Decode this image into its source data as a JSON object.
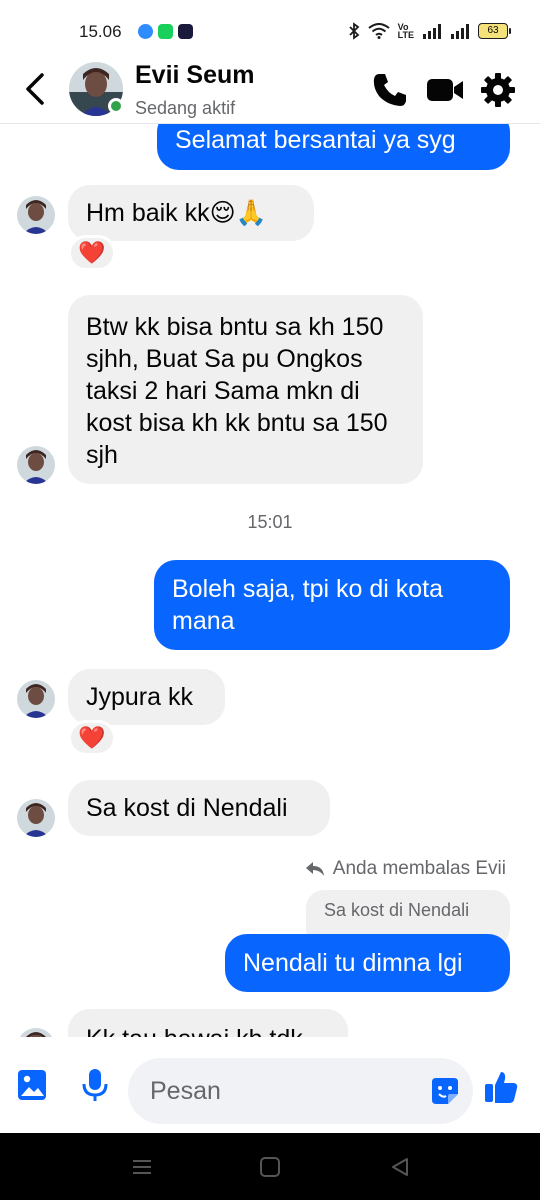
{
  "status_bar": {
    "time": "15.06",
    "volte": "Vo\nLTE",
    "battery": "63"
  },
  "header": {
    "name": "Evii Seum",
    "status": "Sedang aktif",
    "colors": {
      "accent": "#0866ff",
      "online": "#31a24c"
    },
    "icons": [
      "back-arrow-icon",
      "phone-icon",
      "video-call-icon",
      "gear-icon"
    ]
  },
  "messages": {
    "m1": "Selamat bersantai ya syg",
    "m2": "Hm baik kk😌🙏",
    "m2_reaction": "❤️",
    "m3": "Btw kk bisa bntu sa kh 150 sjhh, Buat Sa pu Ongkos taksi 2 hari Sama mkn di kost bisa kh kk bntu sa 150 sjh",
    "timestamp": "15:01",
    "m4": "Boleh saja, tpi ko di kota mana",
    "m5": "Jypura kk",
    "m5_reaction": "❤️",
    "m6": "Sa kost di Nendali",
    "reply_note": "Anda membalas Evii",
    "reply_quote": "Sa kost di Nendali",
    "m7": "Nendali tu dimna lgi",
    "m8": "Kk tau hawai kh tdk"
  },
  "composer": {
    "placeholder": "Pesan",
    "icons": [
      "image-icon",
      "microphone-icon",
      "sticker-icon",
      "thumbs-up-icon"
    ]
  },
  "nav": {
    "icons": [
      "recents-icon",
      "home-icon",
      "back-triangle-icon"
    ]
  }
}
